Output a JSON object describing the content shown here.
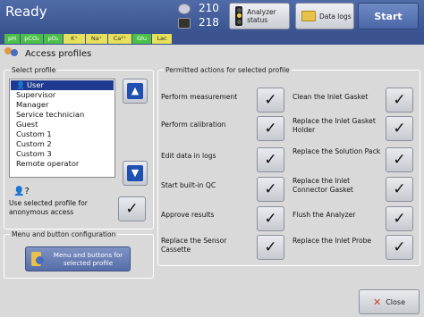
{
  "statusbar": {
    "title": "Ready",
    "counter_top": "210",
    "counter_bottom": "218",
    "analyzer_status": "Analyzer status",
    "data_logs": "Data logs",
    "start": "Start"
  },
  "params": [
    {
      "label": "pH",
      "color": "#4cbf4a"
    },
    {
      "label": "pCO₂",
      "color": "#4cbf4a"
    },
    {
      "label": "pO₂",
      "color": "#4cbf4a"
    },
    {
      "label": "K⁺",
      "color": "#e6e05a"
    },
    {
      "label": "Na⁺",
      "color": "#e6e05a"
    },
    {
      "label": "Ca²⁺",
      "color": "#e6e05a"
    },
    {
      "label": "Glu",
      "color": "#4cbf4a"
    },
    {
      "label": "Lac",
      "color": "#e6e05a"
    }
  ],
  "page": {
    "title": "Access profiles"
  },
  "select_profile": {
    "legend": "Select profile",
    "items": [
      "User",
      "Supervisor",
      "Manager",
      "Service technician",
      "Guest",
      "Custom 1",
      "Custom 2",
      "Custom 3",
      "Remote operator"
    ],
    "selected": "User",
    "anonymous_label": "Use selected profile for anonymous access",
    "anonymous_checked": "✓"
  },
  "permitted": {
    "legend": "Permitted actions for selected profile",
    "left": [
      "Perform measurement",
      "Perform calibration",
      "Edit data in logs",
      "Start built-in QC",
      "Approve results",
      "Replace the Sensor Cassette"
    ],
    "right": [
      "Clean the Inlet Gasket",
      "Replace the Inlet Gasket Holder",
      "Replace the Solution Pack",
      "Replace the Inlet Connector Gasket",
      "Flush the Analyzer",
      "Replace the Inlet Probe"
    ],
    "check": "✓"
  },
  "menu_config": {
    "legend": "Menu and button configuration",
    "button": "Menu and buttons for selected profile"
  },
  "close": "Close",
  "colors": {
    "accent": "#3a5390",
    "selection": "#1f3a8f",
    "panel": "#d9d9d9"
  }
}
